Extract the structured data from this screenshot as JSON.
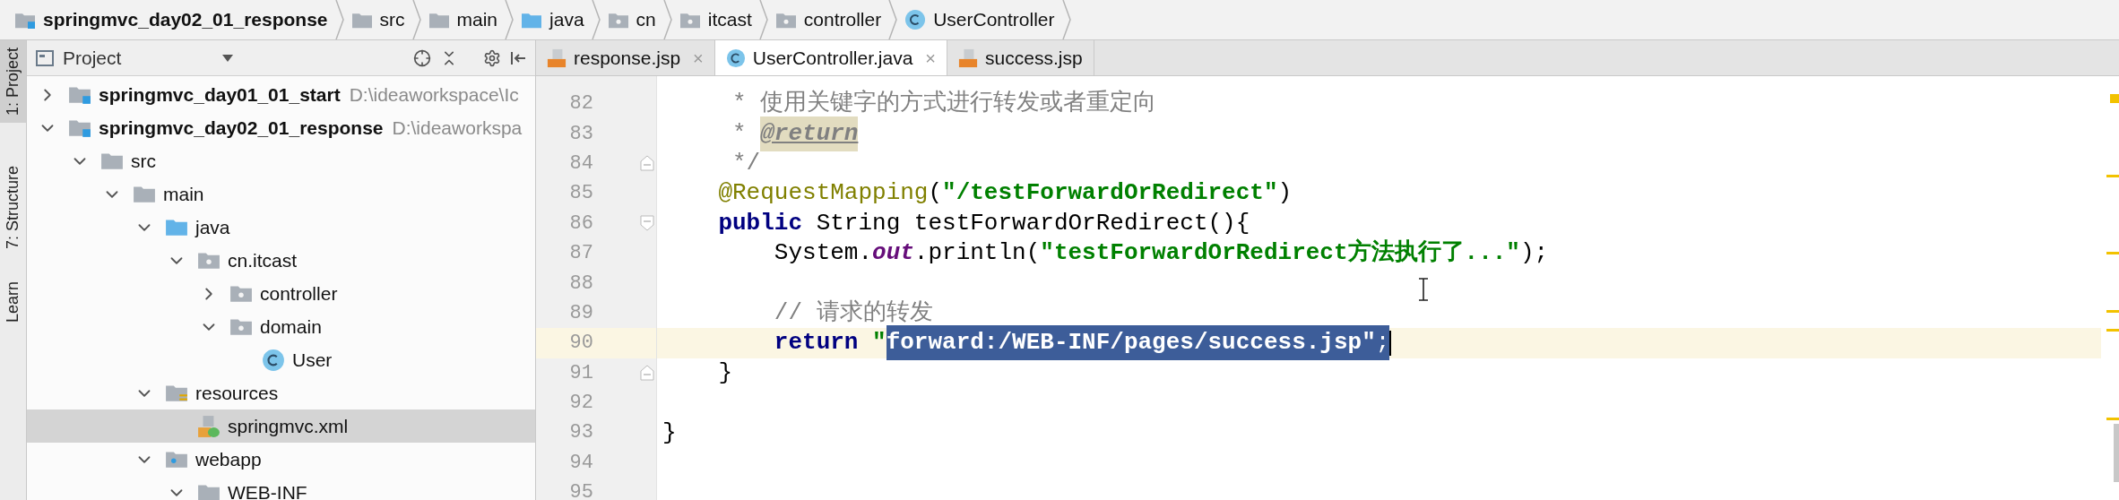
{
  "breadcrumb": [
    {
      "label": "springmvc_day02_01_response",
      "kind": "module"
    },
    {
      "label": "src",
      "kind": "folder"
    },
    {
      "label": "main",
      "kind": "folder"
    },
    {
      "label": "java",
      "kind": "source_folder"
    },
    {
      "label": "cn",
      "kind": "package"
    },
    {
      "label": "itcast",
      "kind": "package"
    },
    {
      "label": "controller",
      "kind": "package"
    },
    {
      "label": "UserController",
      "kind": "class"
    }
  ],
  "tool_strip": [
    {
      "label": "1: Project",
      "selected": true
    },
    {
      "label": "7: Structure",
      "selected": false
    },
    {
      "label": "Learn",
      "selected": false
    }
  ],
  "project_panel": {
    "title": "Project",
    "tree": [
      {
        "name": "springmvc_day01_01_start",
        "kind": "module",
        "path": "D:\\ideaworkspace\\Ic",
        "expanded": false,
        "selected": false
      },
      {
        "name": "springmvc_day02_01_response",
        "kind": "module",
        "path": "D:\\ideaworkspa",
        "expanded": true,
        "selected": false,
        "children": [
          {
            "name": "src",
            "kind": "folder",
            "expanded": true,
            "selected": false,
            "children": [
              {
                "name": "main",
                "kind": "folder",
                "expanded": true,
                "selected": false,
                "children": [
                  {
                    "name": "java",
                    "kind": "source_folder",
                    "expanded": true,
                    "selected": false,
                    "children": [
                      {
                        "name": "cn.itcast",
                        "kind": "package",
                        "expanded": true,
                        "selected": false,
                        "children": [
                          {
                            "name": "controller",
                            "kind": "package",
                            "expanded": false,
                            "selected": false
                          },
                          {
                            "name": "domain",
                            "kind": "package",
                            "expanded": true,
                            "selected": false,
                            "children": [
                              {
                                "name": "User",
                                "kind": "class",
                                "selected": false
                              }
                            ]
                          }
                        ]
                      }
                    ]
                  },
                  {
                    "name": "resources",
                    "kind": "resources_folder",
                    "expanded": true,
                    "selected": false,
                    "children": [
                      {
                        "name": "springmvc.xml",
                        "kind": "xml",
                        "selected": true
                      }
                    ]
                  },
                  {
                    "name": "webapp",
                    "kind": "web_folder",
                    "expanded": true,
                    "selected": false,
                    "children": [
                      {
                        "name": "WEB-INF",
                        "kind": "folder",
                        "expanded": true,
                        "selected": false
                      }
                    ]
                  }
                ]
              }
            ]
          }
        ]
      }
    ]
  },
  "tabs": [
    {
      "label": "response.jsp",
      "kind": "jsp",
      "selected": false,
      "closable": true
    },
    {
      "label": "UserController.java",
      "kind": "class",
      "selected": true,
      "closable": true
    },
    {
      "label": "success.jsp",
      "kind": "jsp",
      "selected": false,
      "closable": false
    }
  ],
  "close_glyph": "×",
  "editor": {
    "lines": [
      {
        "number": "82",
        "current": false,
        "fold_start": false,
        "fold_end": false,
        "tokens": [
          {
            "text": "     * 使用关键字的方式进行转发或者重定向",
            "kind": "doc",
            "selected": false
          }
        ]
      },
      {
        "number": "83",
        "current": false,
        "fold_start": false,
        "fold_end": false,
        "tokens": [
          {
            "text": "     * ",
            "kind": "doc",
            "selected": false
          },
          {
            "text": "@return",
            "kind": "doc_tag",
            "selected": false
          }
        ]
      },
      {
        "number": "84",
        "current": false,
        "fold_start": false,
        "fold_end": true,
        "tokens": [
          {
            "text": "     */",
            "kind": "doc",
            "selected": false
          }
        ]
      },
      {
        "number": "85",
        "current": false,
        "fold_start": false,
        "fold_end": false,
        "tokens": [
          {
            "text": "    @RequestMapping",
            "kind": "annotation",
            "selected": false
          },
          {
            "text": "(",
            "kind": "plain",
            "selected": false
          },
          {
            "text": "\"/testForwardOrRedirect\"",
            "kind": "string",
            "selected": false
          },
          {
            "text": ")",
            "kind": "plain",
            "selected": false
          }
        ]
      },
      {
        "number": "86",
        "current": false,
        "fold_start": true,
        "fold_end": false,
        "tokens": [
          {
            "text": "    public",
            "kind": "keyword",
            "selected": false
          },
          {
            "text": " String testForwardOrRedirect(){",
            "kind": "plain",
            "selected": false
          }
        ]
      },
      {
        "number": "87",
        "current": false,
        "fold_start": false,
        "fold_end": false,
        "tokens": [
          {
            "text": "        System.",
            "kind": "plain",
            "selected": false
          },
          {
            "text": "out",
            "kind": "static_field",
            "selected": false
          },
          {
            "text": ".println(",
            "kind": "plain",
            "selected": false
          },
          {
            "text": "\"testForwardOrRedirect方法执行了...\"",
            "kind": "string",
            "selected": false
          },
          {
            "text": ");",
            "kind": "plain",
            "selected": false
          }
        ]
      },
      {
        "number": "88",
        "current": false,
        "fold_start": false,
        "fold_end": false
      },
      {
        "number": "89",
        "current": false,
        "fold_start": false,
        "fold_end": false,
        "tokens": [
          {
            "text": "        // 请求的转发",
            "kind": "line_comment",
            "selected": false
          }
        ]
      },
      {
        "number": "90",
        "current": true,
        "fold_start": false,
        "fold_end": false,
        "tokens": [
          {
            "text": "        return",
            "kind": "keyword",
            "selected": false
          },
          {
            "text": " \"",
            "kind": "string",
            "selected": false
          },
          {
            "text": "forward:/WEB-INF/pages/success.jsp\"",
            "kind": "string",
            "selected": true
          },
          {
            "text": ";",
            "kind": "plain",
            "selected": true
          }
        ]
      },
      {
        "number": "91",
        "current": false,
        "fold_start": false,
        "fold_end": true,
        "tokens": [
          {
            "text": "    }",
            "kind": "plain",
            "selected": false
          }
        ]
      },
      {
        "number": "92",
        "current": false,
        "fold_start": false,
        "fold_end": false
      },
      {
        "number": "93",
        "current": false,
        "fold_start": false,
        "fold_end": false,
        "tokens": [
          {
            "text": "}",
            "kind": "plain",
            "selected": false
          }
        ]
      },
      {
        "number": "94",
        "current": false,
        "fold_start": false,
        "fold_end": false
      },
      {
        "number": "95",
        "current": false,
        "fold_start": false,
        "fold_end": false
      }
    ]
  }
}
